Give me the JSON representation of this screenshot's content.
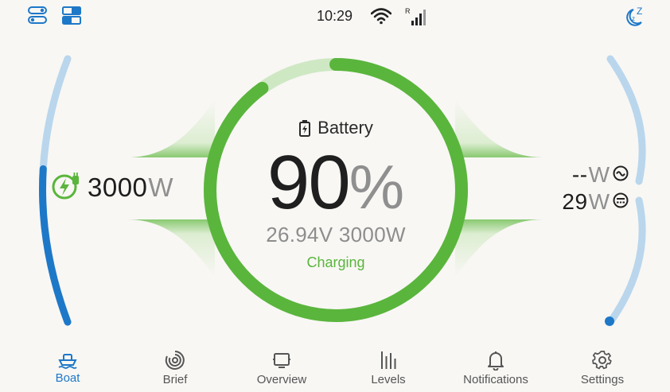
{
  "status_bar": {
    "time": "10:29",
    "signal_label": "R",
    "icons": [
      "toggles-icon",
      "layout-icon",
      "wifi-icon",
      "signal-icon",
      "sleep-moon-icon"
    ]
  },
  "left_gauge": {
    "value": "3000",
    "unit": "W",
    "icon": "shore-power-icon",
    "level_fraction": 0.58
  },
  "battery": {
    "title": "Battery",
    "percent": "90",
    "percent_sign": "%",
    "voltage_and_power": "26.94V 3000W",
    "state": "Charging",
    "level_fraction": 0.9,
    "icon": "battery-charging-icon"
  },
  "right_gauge": {
    "rows": [
      {
        "value": "--",
        "unit": "W",
        "icon": "ac-output-icon"
      },
      {
        "value": "29",
        "unit": "W",
        "icon": "dc-output-icon"
      }
    ],
    "level_fraction": 0.0
  },
  "nav": {
    "items": [
      {
        "label": "Boat",
        "icon": "boat-icon",
        "active": true
      },
      {
        "label": "Brief",
        "icon": "brief-icon",
        "active": false
      },
      {
        "label": "Overview",
        "icon": "overview-icon",
        "active": false
      },
      {
        "label": "Levels",
        "icon": "levels-icon",
        "active": false
      },
      {
        "label": "Notifications",
        "icon": "bell-icon",
        "active": false
      },
      {
        "label": "Settings",
        "icon": "gear-icon",
        "active": false
      }
    ]
  },
  "colors": {
    "accent_blue": "#1e78c8",
    "light_blue": "#b9d6ec",
    "battery_green": "#5ab53c",
    "battery_green_light": "#cfe8c4",
    "background": "#f8f7f4"
  }
}
